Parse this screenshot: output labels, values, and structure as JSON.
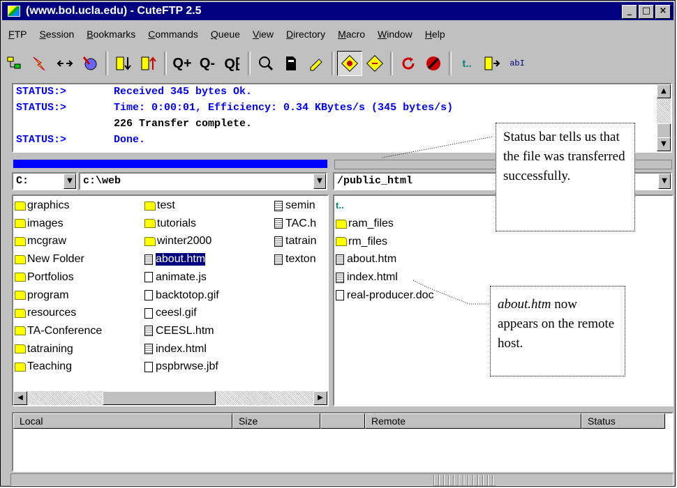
{
  "window": {
    "title": "(www.bol.ucla.edu) - CuteFTP 2.5",
    "controls": [
      "_",
      "□",
      "×"
    ]
  },
  "menu": [
    "FTP",
    "Session",
    "Bookmarks",
    "Commands",
    "Queue",
    "View",
    "Directory",
    "Macro",
    "Window",
    "Help"
  ],
  "toolbar_labels": {
    "zoom_in": "Q+",
    "zoom_out": "Q-",
    "zoom_special": "Q⁅",
    "text": "abI",
    "up": "t.."
  },
  "log": [
    {
      "key": "STATUS:>",
      "value": "Received 345 bytes Ok."
    },
    {
      "key": "STATUS:>",
      "value": "Time: 0:00:01, Efficiency: 0.34 KBytes/s (345 bytes/s)"
    },
    {
      "key": "",
      "value": "226 Transfer complete."
    },
    {
      "key": "STATUS:>",
      "value": "Done."
    }
  ],
  "local": {
    "drive": "C:",
    "path": "c:\\web",
    "col1": [
      "graphics",
      "images",
      "mcgraw",
      "New Folder",
      "Portfolios",
      "program",
      "resources",
      "TA-Conference",
      "tatraining",
      "Teaching"
    ],
    "col2": [
      {
        "name": "test",
        "type": "folder"
      },
      {
        "name": "tutorials",
        "type": "folder"
      },
      {
        "name": "winter2000",
        "type": "folder"
      },
      {
        "name": "about.htm",
        "type": "doc",
        "selected": true
      },
      {
        "name": "animate.js",
        "type": "file"
      },
      {
        "name": "backtotop.gif",
        "type": "file"
      },
      {
        "name": "ceesl.gif",
        "type": "file"
      },
      {
        "name": "CEESL.htm",
        "type": "doc"
      },
      {
        "name": "index.html",
        "type": "doc"
      },
      {
        "name": "pspbrwse.jbf",
        "type": "file"
      }
    ],
    "col3": [
      "semin",
      "TAC.h",
      "tatrain",
      "texton"
    ]
  },
  "remote": {
    "path": "/public_html",
    "up_label": "t..",
    "items": [
      {
        "name": "ram_files",
        "type": "folder"
      },
      {
        "name": "rm_files",
        "type": "folder"
      },
      {
        "name": "about.htm",
        "type": "doc"
      },
      {
        "name": "index.html",
        "type": "doc"
      },
      {
        "name": "real-producer.doc",
        "type": "file"
      }
    ]
  },
  "queue": {
    "columns": [
      "Local",
      "Size",
      "",
      "Remote",
      "Status"
    ]
  },
  "callouts": {
    "status": "Status bar  tells us that the file was transferred successfully.",
    "about_em": "about.htm",
    "about_rest": " now appears on the remote host."
  }
}
